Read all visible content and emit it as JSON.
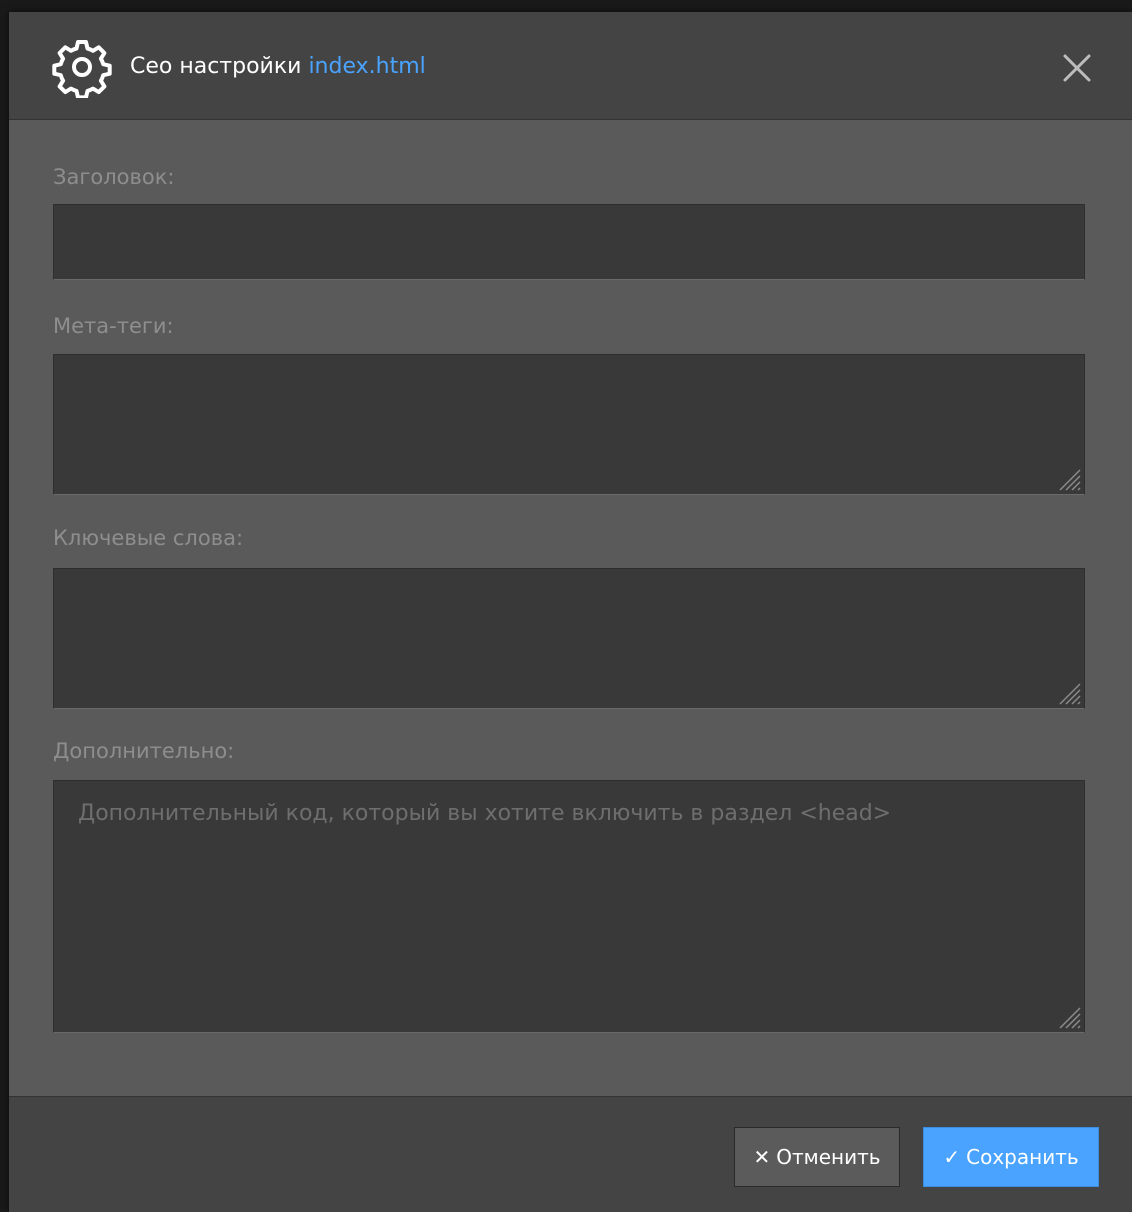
{
  "dialog": {
    "title_prefix": "Сео настройки",
    "filename": "index.html",
    "icons": {
      "header": "gear-icon",
      "close": "close-icon"
    }
  },
  "fields": {
    "title": {
      "label": "Заголовок:",
      "value": ""
    },
    "meta_tags": {
      "label": "Мета-теги:",
      "value": ""
    },
    "keywords": {
      "label": "Ключевые слова:",
      "value": ""
    },
    "extra": {
      "label": "Дополнительно:",
      "value": "",
      "placeholder": "Дополнительный код, который вы хотите включить в раздел <head>"
    }
  },
  "footer": {
    "cancel_icon": "✕",
    "cancel_label": "Отменить",
    "save_icon": "✓",
    "save_label": "Сохранить"
  },
  "colors": {
    "accent": "#4aa3ff",
    "panel": "#5a5a5a",
    "header": "#444444",
    "input": "#393939"
  }
}
